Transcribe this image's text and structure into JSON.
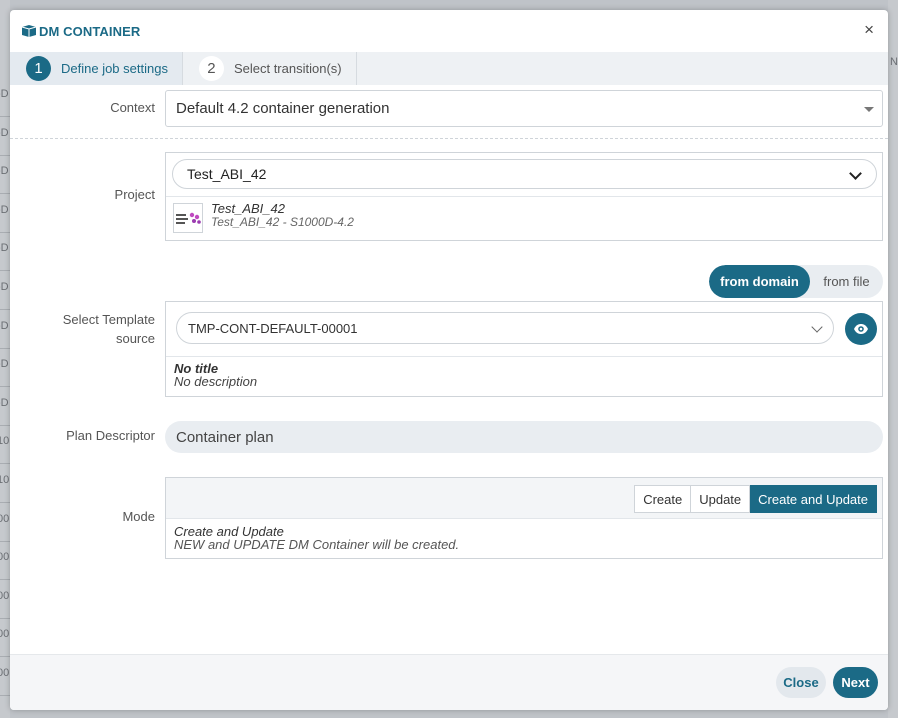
{
  "dialog": {
    "title": "DM CONTAINER",
    "close_glyph": "×"
  },
  "steps": [
    {
      "number": "1",
      "label": "Define job settings",
      "active": true
    },
    {
      "number": "2",
      "label": "Select transition(s)",
      "active": false
    }
  ],
  "form": {
    "context": {
      "label": "Context",
      "value": "Default 4.2 container generation"
    },
    "project": {
      "label": "Project",
      "selected": "Test_ABI_42",
      "card_name": "Test_ABI_42",
      "card_desc": "Test_ABI_42 - S1000D-4.2"
    },
    "template_source": {
      "label_line1": "Select Template",
      "label_line2": "source",
      "toggle_options": [
        "from domain",
        "from file"
      ],
      "toggle_selected": "from domain",
      "selected": "TMP-CONT-DEFAULT-00001",
      "title": "No title",
      "description": "No description"
    },
    "plan_descriptor": {
      "label": "Plan Descriptor",
      "value": "Container plan"
    },
    "mode": {
      "label": "Mode",
      "options": [
        "Create",
        "Update",
        "Create and Update"
      ],
      "selected": "Create and Update",
      "title": "Create and Update",
      "description": "NEW and UPDATE DM Container will be created."
    }
  },
  "footer": {
    "close_label": "Close",
    "next_label": "Next"
  },
  "background": {
    "row_fragments": [
      "-D",
      "-D",
      "-D",
      "-D",
      "-D",
      "-D",
      "-D",
      "-D",
      "-D",
      "10",
      "10",
      "00",
      "00",
      "00",
      "00",
      "00"
    ],
    "top_right_fragment": "N"
  },
  "colors": {
    "accent": "#1b6a86",
    "overlay": "#bfc3c8"
  },
  "icons": {
    "title": "container-icon",
    "eye": "eye-icon",
    "project_thumb": "project-logo-icon"
  }
}
